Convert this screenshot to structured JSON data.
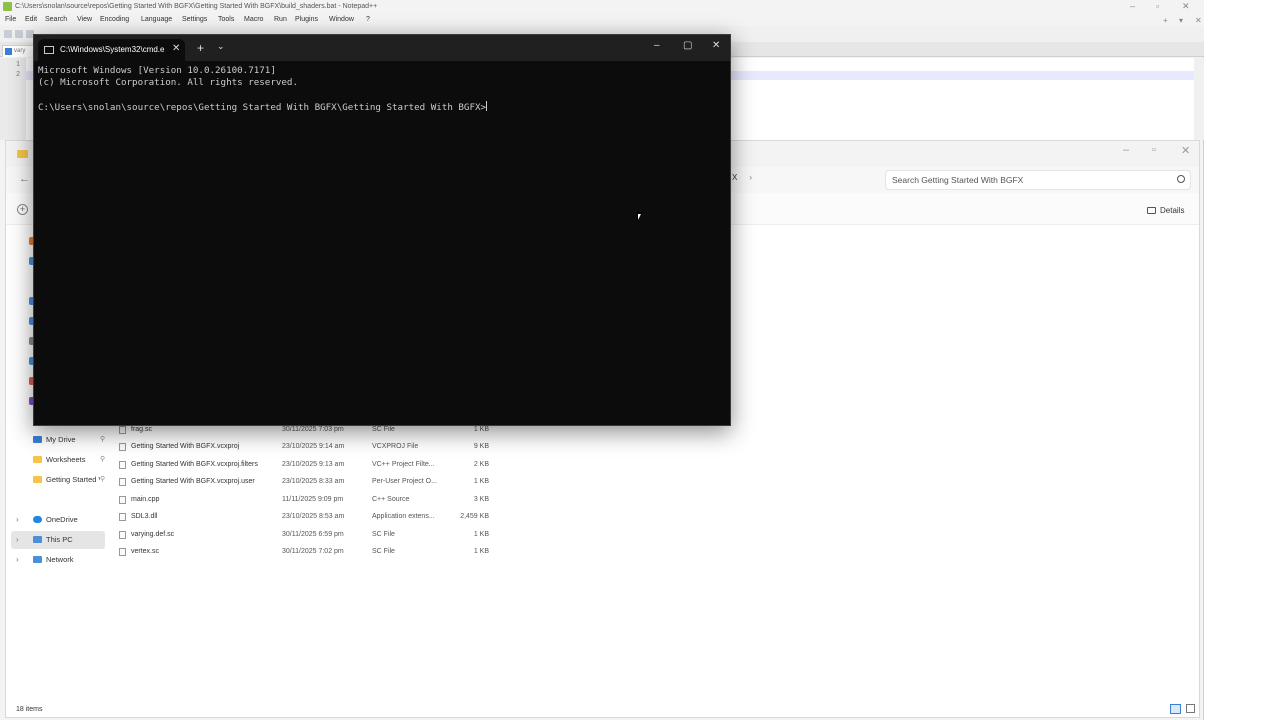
{
  "notepadpp": {
    "title": "C:\\Users\\snolan\\source\\repos\\Getting Started With BGFX\\Getting Started With BGFX\\build_shaders.bat - Notepad++",
    "menu": [
      "File",
      "Edit",
      "Search",
      "View",
      "Encoding",
      "Language",
      "Settings",
      "Tools",
      "Macro",
      "Run",
      "Plugins",
      "Window",
      "?"
    ],
    "menu_right": [
      "+",
      "▾",
      "✕"
    ],
    "tab_label": "vary",
    "line_numbers": [
      "1",
      "2"
    ]
  },
  "explorer": {
    "address_tail": "X",
    "search_placeholder": "Search Getting Started With BGFX",
    "details_label": "Details",
    "sidebar": [
      {
        "label": "My Drive",
        "pinned": true,
        "icon_color": "#3b7fd6"
      },
      {
        "label": "Worksheets",
        "pinned": true,
        "icon_color": "#f4c54a"
      },
      {
        "label": "Getting Started V",
        "pinned": true,
        "icon_color": "#f4c54a"
      },
      {
        "label": "OneDrive",
        "pinned": false,
        "icon_color": "#1e88e5"
      },
      {
        "label": "This PC",
        "pinned": false,
        "icon_color": "#4a90d9",
        "selected": true
      },
      {
        "label": "Network",
        "pinned": false,
        "icon_color": "#4a90d9"
      }
    ],
    "files": [
      {
        "name": "frag.sc",
        "date": "30/11/2025 7:03 pm",
        "type": "SC File",
        "size": "1 KB"
      },
      {
        "name": "Getting Started With BGFX.vcxproj",
        "date": "23/10/2025 9:14 am",
        "type": "VCXPROJ File",
        "size": "9 KB"
      },
      {
        "name": "Getting Started With BGFX.vcxproj.filters",
        "date": "23/10/2025 9:13 am",
        "type": "VC++ Project Filte...",
        "size": "2 KB"
      },
      {
        "name": "Getting Started With BGFX.vcxproj.user",
        "date": "23/10/2025 8:33 am",
        "type": "Per-User Project O...",
        "size": "1 KB"
      },
      {
        "name": "main.cpp",
        "date": "11/11/2025 9:09 pm",
        "type": "C++ Source",
        "size": "3 KB"
      },
      {
        "name": "SDL3.dll",
        "date": "23/10/2025 8:53 am",
        "type": "Application extens...",
        "size": "2,459 KB"
      },
      {
        "name": "varying.def.sc",
        "date": "30/11/2025 6:59 pm",
        "type": "SC File",
        "size": "1 KB"
      },
      {
        "name": "vertex.sc",
        "date": "30/11/2025 7:02 pm",
        "type": "SC File",
        "size": "1 KB"
      }
    ],
    "status": "18 items"
  },
  "terminal": {
    "tab_title": "C:\\Windows\\System32\\cmd.e",
    "lines": [
      "Microsoft Windows [Version 10.0.26100.7171]",
      "(c) Microsoft Corporation. All rights reserved.",
      "",
      "C:\\Users\\snolan\\source\\repos\\Getting Started With BGFX\\Getting Started With BGFX>"
    ]
  },
  "colors": {
    "terminal_bg": "#0c0c0c",
    "terminal_fg": "#cccccc",
    "accent": "#3b7fd6"
  }
}
